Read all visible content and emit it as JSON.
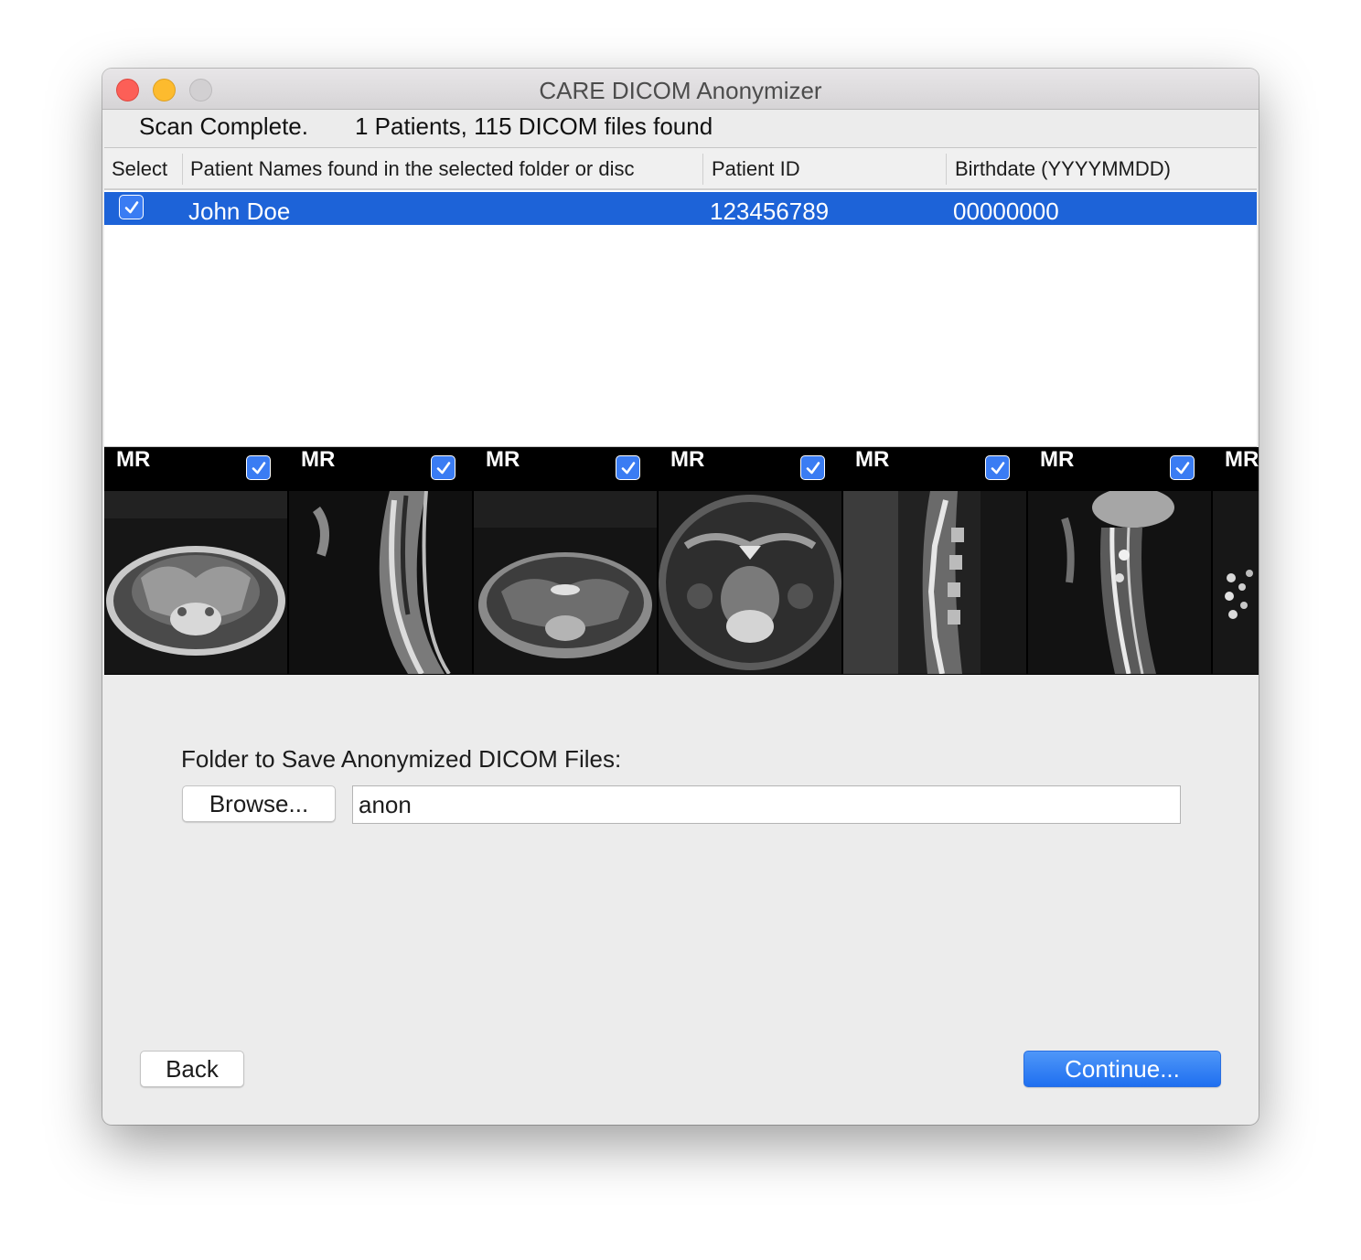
{
  "window": {
    "title": "CARE DICOM Anonymizer"
  },
  "status": {
    "state": "Scan Complete.",
    "summary": "1 Patients, 115 DICOM files found"
  },
  "table": {
    "columns": [
      "Select",
      "Patient Names found in the selected folder or disc",
      "Patient ID",
      "Birthdate (YYYYMMDD)"
    ],
    "rows": [
      {
        "selected": true,
        "name": "John Doe",
        "patient_id": "123456789",
        "birthdate": "00000000"
      }
    ]
  },
  "thumbnails": [
    {
      "modality": "MR",
      "checked": true,
      "view": "axial-pelvis"
    },
    {
      "modality": "MR",
      "checked": true,
      "view": "sagittal-cervical-spine"
    },
    {
      "modality": "MR",
      "checked": true,
      "view": "axial-pelvis"
    },
    {
      "modality": "MR",
      "checked": true,
      "view": "axial-pelvis-bladder"
    },
    {
      "modality": "MR",
      "checked": true,
      "view": "sagittal-lumbar-spine"
    },
    {
      "modality": "MR",
      "checked": true,
      "view": "sagittal-cervical-spine"
    },
    {
      "modality": "MR",
      "checked": true,
      "view": "axial-partial"
    }
  ],
  "output": {
    "label": "Folder to Save Anonymized DICOM Files:",
    "browse_label": "Browse...",
    "folder_value": "anon"
  },
  "footer": {
    "back_label": "Back",
    "continue_label": "Continue..."
  },
  "colors": {
    "selection": "#1d63d8",
    "accent": "#3a7cf3",
    "window_bg": "#ececec"
  }
}
